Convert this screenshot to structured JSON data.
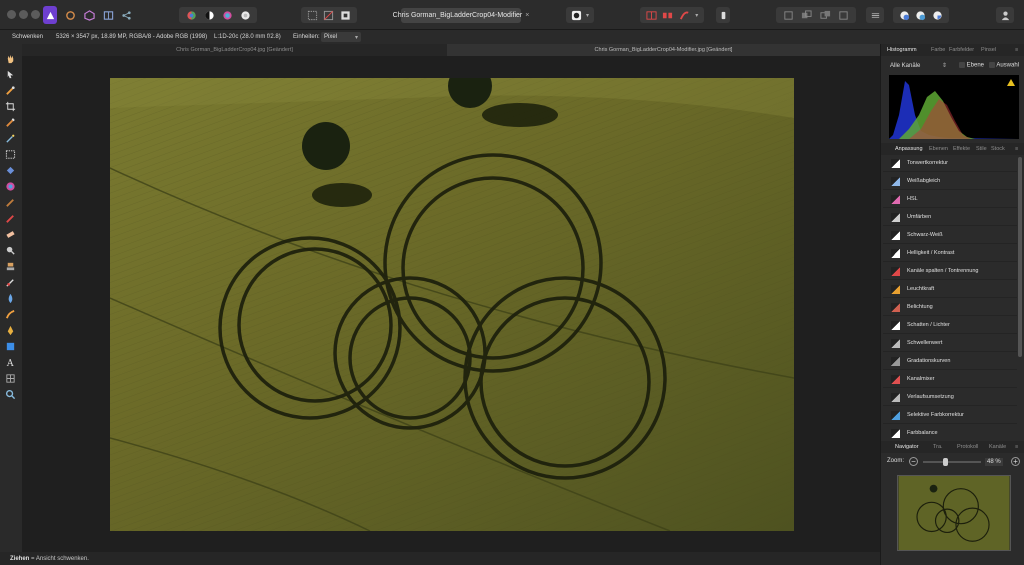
{
  "toolbar": {
    "doc_title": "Chris Gorman_BigLadderCrop04-Modifier",
    "doc_close": "×"
  },
  "context": {
    "tool": "Schwenken",
    "info": "5326 × 3547 px, 18.89 MP, RGBA/8 - Adobe RGB (1998)",
    "lens": "L:1D-20c (28.0 mm f/2.8)",
    "units_label": "Einheiten:",
    "units_value": "Pixel"
  },
  "doc_tabs": [
    {
      "label": "Chris Gorman_BigLadderCrop04.jpg [Geändert]"
    },
    {
      "label": "Chris Gorman_BigLadderCrop04-Modifier.jpg [Geändert]"
    }
  ],
  "status": {
    "bold": "Ziehen",
    "rest": " = Ansicht schwenken."
  },
  "panels": {
    "top_tabs": [
      "Histogramm",
      "Farbe",
      "Farbfelder",
      "Pinsel"
    ],
    "channels": "Alle Kanäle",
    "layer_label": "Ebene",
    "selection_label": "Auswahl",
    "mid_tabs": [
      "Anpassung",
      "Ebenen",
      "Effekte",
      "Stile",
      "Stock"
    ],
    "adjustments": [
      {
        "label": "Tonwertkorrektur",
        "icon": "levels-icon",
        "color": "#ffffff"
      },
      {
        "label": "Weißabgleich",
        "icon": "white-balance-icon",
        "color": "#8fb7e8"
      },
      {
        "label": "HSL",
        "icon": "hsl-icon",
        "color": "#e06ab0"
      },
      {
        "label": "Umfärben",
        "icon": "recolor-icon",
        "color": "#cfcfcf"
      },
      {
        "label": "Schwarz-Weiß",
        "icon": "black-white-icon",
        "color": "#ffffff"
      },
      {
        "label": "Helligkeit / Kontrast",
        "icon": "brightness-icon",
        "color": "#ffffff"
      },
      {
        "label": "Kanäle spalten / Tontrennung",
        "icon": "posterize-icon",
        "color": "#e04848"
      },
      {
        "label": "Leuchtkraft",
        "icon": "vibrance-icon",
        "color": "#e8a030"
      },
      {
        "label": "Belichtung",
        "icon": "exposure-icon",
        "color": "#d06050"
      },
      {
        "label": "Schatten / Lichter",
        "icon": "shadows-highlights-icon",
        "color": "#ffffff"
      },
      {
        "label": "Schwellenwert",
        "icon": "threshold-icon",
        "color": "#bbbbbb"
      },
      {
        "label": "Gradationskurven",
        "icon": "curves-icon",
        "color": "#999999"
      },
      {
        "label": "Kanalmixer",
        "icon": "channel-mixer-icon",
        "color": "#e05050"
      },
      {
        "label": "Verlaufsumsetzung",
        "icon": "gradient-map-icon",
        "color": "#bbbbbb"
      },
      {
        "label": "Selektive Farbkorrektur",
        "icon": "selective-color-icon",
        "color": "#4fa0e0"
      },
      {
        "label": "Farbbalance",
        "icon": "color-balance-icon",
        "color": "#ffffff"
      }
    ],
    "bottom_tabs": [
      "Navigator",
      "Tra.",
      "Protokoll",
      "Kanäle"
    ],
    "zoom_label": "Zoom:",
    "zoom_value": "48 %",
    "zoom_level": 0.48
  }
}
